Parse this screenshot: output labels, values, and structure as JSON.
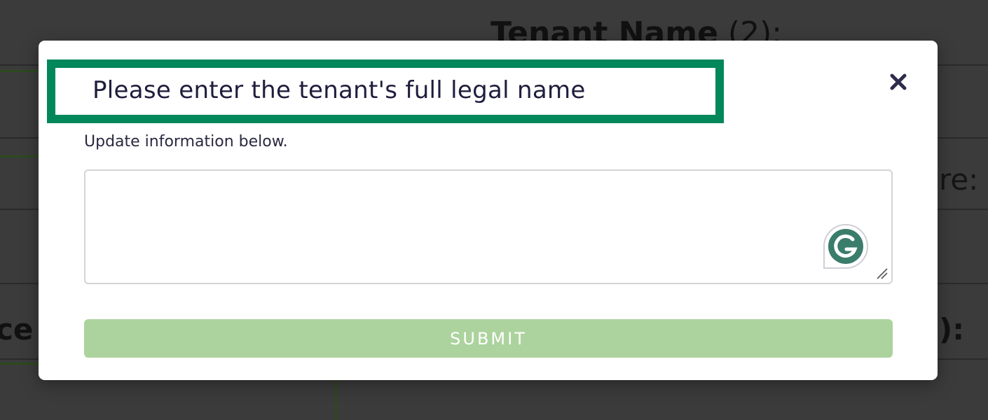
{
  "background": {
    "heading_bold": "Tenant Name",
    "heading_light": " (2):",
    "right_fragment_1": "re:",
    "right_fragment_2": "):",
    "left_fragment": "ce"
  },
  "modal": {
    "title": "Please enter the tenant's full legal name",
    "subtitle": "Update information below.",
    "textarea_value": "",
    "textarea_placeholder": "",
    "submit_label": "SUBMIT",
    "close_icon": "close-icon",
    "grammarly_icon": "grammarly-icon"
  },
  "colors": {
    "highlight_border": "#02875a",
    "submit_bg": "#acd39d",
    "title_text": "#1f1d3d",
    "grammarly_green": "#3a7d6a"
  }
}
